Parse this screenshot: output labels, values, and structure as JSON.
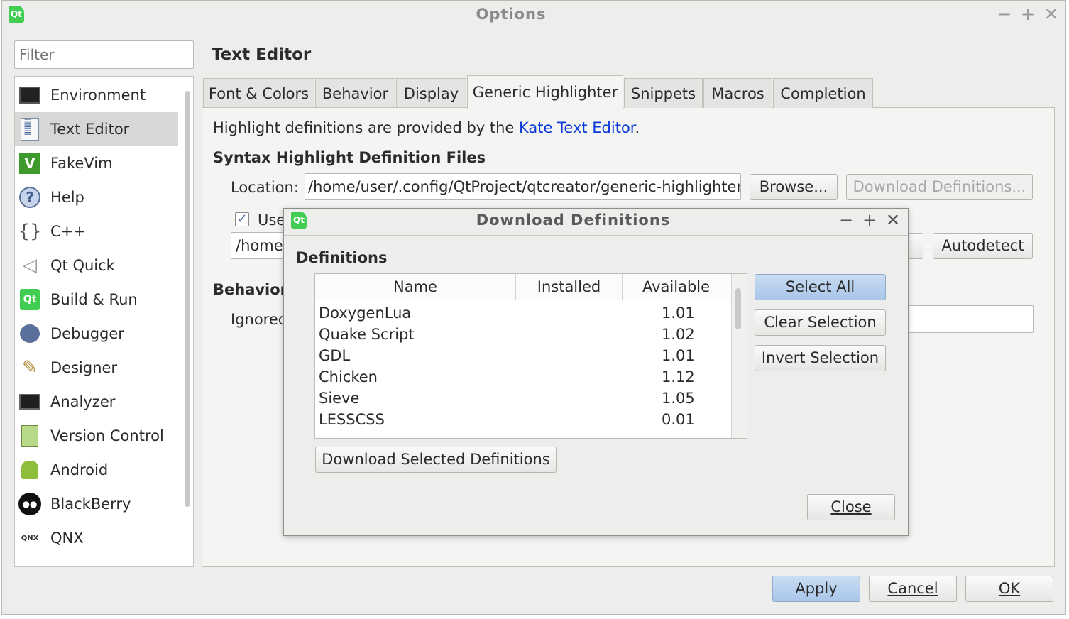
{
  "window": {
    "title": "Options"
  },
  "filter": {
    "placeholder": "Filter"
  },
  "categories": [
    {
      "label": "Environment",
      "icon": "monitor-icon"
    },
    {
      "label": "Text Editor",
      "icon": "text-editor-icon",
      "selected": true
    },
    {
      "label": "FakeVim",
      "icon": "fakevim-icon"
    },
    {
      "label": "Help",
      "icon": "help-icon"
    },
    {
      "label": "C++",
      "icon": "braces-icon"
    },
    {
      "label": "Qt Quick",
      "icon": "paper-plane-icon"
    },
    {
      "label": "Build & Run",
      "icon": "build-run-icon"
    },
    {
      "label": "Debugger",
      "icon": "debugger-icon"
    },
    {
      "label": "Designer",
      "icon": "designer-icon"
    },
    {
      "label": "Analyzer",
      "icon": "analyzer-icon"
    },
    {
      "label": "Version Control",
      "icon": "version-control-icon"
    },
    {
      "label": "Android",
      "icon": "android-icon"
    },
    {
      "label": "BlackBerry",
      "icon": "blackberry-icon"
    },
    {
      "label": "QNX",
      "icon": "qnx-icon"
    }
  ],
  "page": {
    "title": "Text Editor"
  },
  "tabs": [
    {
      "label": "Font & Colors"
    },
    {
      "label": "Behavior"
    },
    {
      "label": "Display"
    },
    {
      "label": "Generic Highlighter",
      "active": true
    },
    {
      "label": "Snippets"
    },
    {
      "label": "Macros"
    },
    {
      "label": "Completion"
    }
  ],
  "highlighter": {
    "info_prefix": "Highlight definitions are provided by the ",
    "info_link": "Kate Text Editor",
    "info_suffix": ".",
    "section_title": "Syntax Highlight Definition Files",
    "location_label": "Location:",
    "location_value": "/home/user/.config/QtProject/qtcreator/generic-highlighter",
    "browse_label": "Browse...",
    "download_label": "Download Definitions...",
    "use_label": "Use",
    "use_checked": true,
    "fallback_value": "/home",
    "autodetect_label": "Autodetect",
    "behavior_title": "Behavior",
    "ignored_label": "Ignored"
  },
  "dialog": {
    "title": "Download Definitions",
    "section_label": "Definitions",
    "columns": [
      "Name",
      "Installed",
      "Available"
    ],
    "rows": [
      {
        "name": "DoxygenLua",
        "installed": "",
        "available": "1.01"
      },
      {
        "name": "Quake Script",
        "installed": "",
        "available": "1.02"
      },
      {
        "name": "GDL",
        "installed": "",
        "available": "1.01"
      },
      {
        "name": "Chicken",
        "installed": "",
        "available": "1.12"
      },
      {
        "name": "Sieve",
        "installed": "",
        "available": "1.05"
      },
      {
        "name": "LESSCSS",
        "installed": "",
        "available": "0.01"
      }
    ],
    "select_all_label": "Select All",
    "clear_selection_label": "Clear Selection",
    "invert_selection_label": "Invert Selection",
    "download_selected_label": "Download Selected Definitions",
    "close_label": "Close"
  },
  "footer": {
    "apply_label": "Apply",
    "cancel_label": "Cancel",
    "ok_label": "OK"
  },
  "colors": {
    "accent": "#a9c6ea",
    "link": "#0a3ad9",
    "qt_green": "#41cd52"
  }
}
